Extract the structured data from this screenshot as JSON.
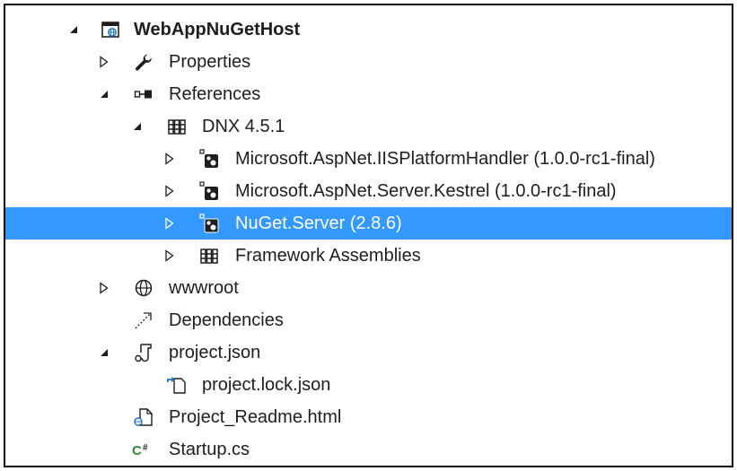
{
  "solution_explorer": {
    "items": [
      {
        "label": "WebAppNuGetHost",
        "icon": "web-project-icon",
        "expander": "expanded",
        "selected": false
      },
      {
        "label": "Properties",
        "icon": "wrench-icon",
        "expander": "collapsed",
        "selected": false
      },
      {
        "label": "References",
        "icon": "references-icon",
        "expander": "expanded",
        "selected": false
      },
      {
        "label": "DNX 4.5.1",
        "icon": "library-icon",
        "expander": "expanded",
        "selected": false
      },
      {
        "label": "Microsoft.AspNet.IISPlatformHandler (1.0.0-rc1-final)",
        "icon": "nuget-package-icon",
        "expander": "collapsed",
        "selected": false
      },
      {
        "label": "Microsoft.AspNet.Server.Kestrel (1.0.0-rc1-final)",
        "icon": "nuget-package-icon",
        "expander": "collapsed",
        "selected": false
      },
      {
        "label": "NuGet.Server (2.8.6)",
        "icon": "nuget-package-icon",
        "expander": "collapsed",
        "selected": true
      },
      {
        "label": "Framework Assemblies",
        "icon": "library-icon",
        "expander": "collapsed",
        "selected": false
      },
      {
        "label": "wwwroot",
        "icon": "globe-icon",
        "expander": "collapsed",
        "selected": false
      },
      {
        "label": "Dependencies",
        "icon": "dependencies-arrow-icon",
        "expander": "none",
        "selected": false
      },
      {
        "label": "project.json",
        "icon": "json-file-icon",
        "expander": "expanded",
        "selected": false
      },
      {
        "label": "project.lock.json",
        "icon": "lock-file-icon",
        "expander": "none",
        "selected": false
      },
      {
        "label": "Project_Readme.html",
        "icon": "html-file-icon",
        "expander": "none",
        "selected": false
      },
      {
        "label": "Startup.cs",
        "icon": "csharp-file-icon",
        "expander": "none",
        "selected": false
      }
    ],
    "colors": {
      "selection": "#3399ff",
      "text": "#1e1e1e",
      "selected_text": "#ffffff",
      "frame_border": "#000000"
    }
  }
}
